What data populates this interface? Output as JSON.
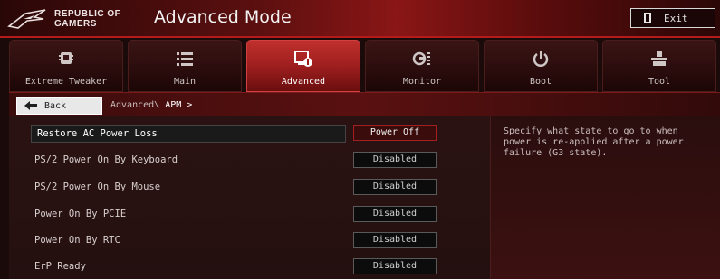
{
  "header": {
    "logo_text_line1": "REPUBLIC OF",
    "logo_text_line2": "GAMERS",
    "mode_title": "Advanced Mode",
    "exit_label": "Exit"
  },
  "tabs": [
    {
      "label": "Extreme Tweaker",
      "icon": "chip-icon",
      "active": false
    },
    {
      "label": "Main",
      "icon": "list-icon",
      "active": false
    },
    {
      "label": "Advanced",
      "icon": "advanced-info-icon",
      "active": true
    },
    {
      "label": "Monitor",
      "icon": "monitor-gauge-icon",
      "active": false
    },
    {
      "label": "Boot",
      "icon": "power-icon",
      "active": false
    },
    {
      "label": "Tool",
      "icon": "tool-icon",
      "active": false
    }
  ],
  "breadcrumb": {
    "back_label": "Back",
    "path": "Advanced\\",
    "current": "APM >"
  },
  "settings": [
    {
      "label": "Restore AC Power Loss",
      "value": "Power Off"
    },
    {
      "label": "PS/2 Power On By Keyboard",
      "value": "Disabled"
    },
    {
      "label": "PS/2 Power On By Mouse",
      "value": "Disabled"
    },
    {
      "label": "Power On By PCIE",
      "value": "Disabled"
    },
    {
      "label": "Power On By RTC",
      "value": "Disabled"
    },
    {
      "label": "ErP Ready",
      "value": "Disabled"
    }
  ],
  "help_text": "Specify what state to go to when power is re-applied after a power failure (G3 state).",
  "colors": {
    "accent": "#b41c1c",
    "active_tab": "#c0302d"
  }
}
